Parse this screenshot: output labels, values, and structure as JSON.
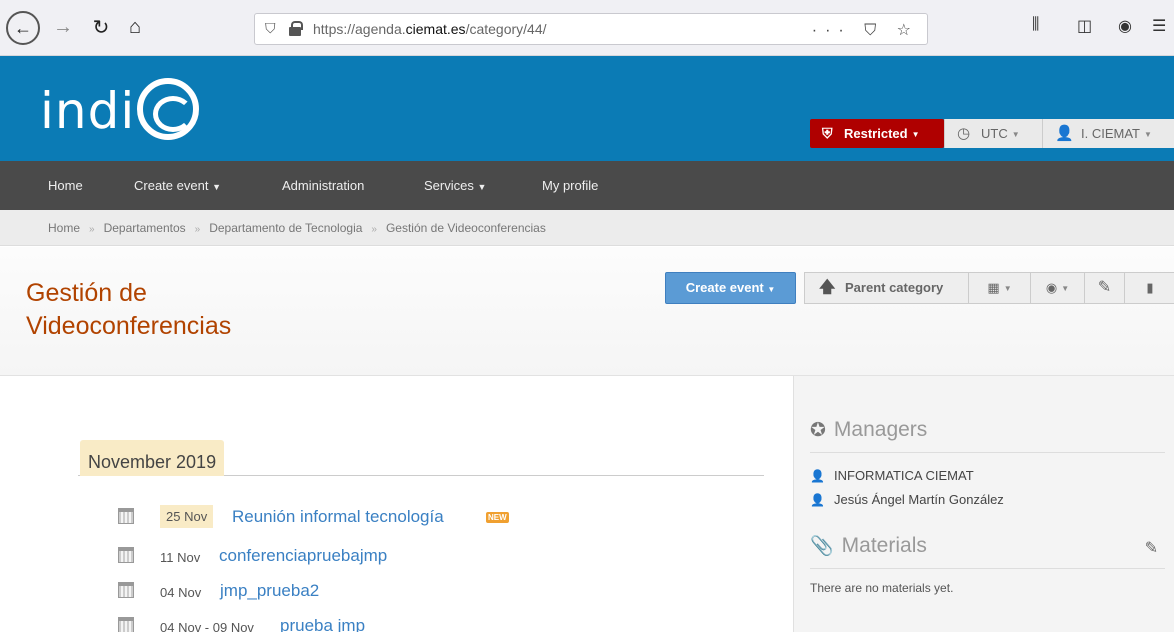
{
  "browser": {
    "url_prefix": "https://agenda.",
    "url_domain": "ciemat.es",
    "url_path": "/category/44/",
    "url_actions": "··· ⛉ ☆"
  },
  "header": {
    "logo_text": "indi",
    "restricted_label": "Restricted",
    "timezone_label": "UTC",
    "user_label": "I. CIEMAT"
  },
  "menu": {
    "items": [
      {
        "label": "Home"
      },
      {
        "label": "Create event"
      },
      {
        "label": "Administration"
      },
      {
        "label": "Services"
      },
      {
        "label": "My profile"
      }
    ]
  },
  "breadcrumb": {
    "items": [
      "Home",
      "Departamentos",
      "Departamento de Tecnologia",
      "Gestión de Videoconferencias"
    ],
    "separator": "»"
  },
  "category": {
    "title": "Gestión de Videoconferencias",
    "create_event_label": "Create event",
    "parent_category_label": "Parent category"
  },
  "events": {
    "month": "November 2019",
    "list": [
      {
        "date": "25 Nov",
        "title": "Reunión informal tecnología",
        "badge": "NEW"
      },
      {
        "date": "11 Nov",
        "title": "conferenciapruebajmp"
      },
      {
        "date": "04 Nov",
        "title": "jmp_prueba2"
      },
      {
        "date": "04 Nov - 09 Nov",
        "title": "prueba jmp"
      }
    ]
  },
  "sidebar": {
    "managers_heading": "Managers",
    "managers": [
      "INFORMATICA CIEMAT",
      "Jesús Ángel Martín González"
    ],
    "materials_heading": "Materials",
    "no_materials_text": "There are no materials yet."
  },
  "colors": {
    "header_blue": "#0b7bb5",
    "restricted_red": "#af0000",
    "title_orange": "#b14300",
    "link_blue": "#3a80c3",
    "create_button_blue": "#5b9bd5"
  }
}
